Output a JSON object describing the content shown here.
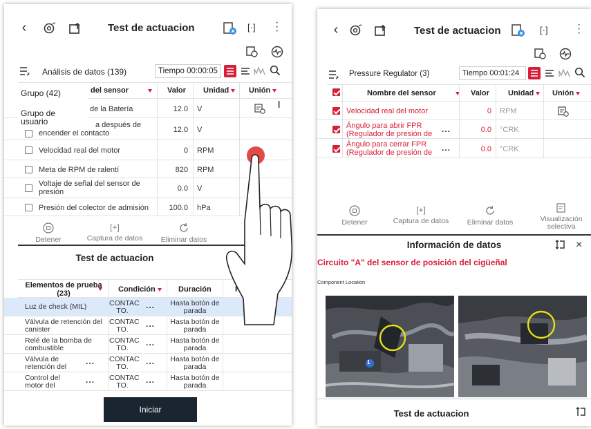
{
  "left": {
    "header": {
      "back": "‹",
      "title": "Test de actuacion"
    },
    "analysis": {
      "label": "Análisis de datos (139)",
      "time": "Tiempo 00:00:05"
    },
    "menu": {
      "group": "Grupo (42)",
      "user_group": "Grupo de usuario"
    },
    "columns": {
      "sensor": "del sensor",
      "value": "Valor",
      "unit": "Unidad",
      "union": "Unión"
    },
    "rows": [
      {
        "name": "de la Batería",
        "value": "12.0",
        "unit": "V"
      },
      {
        "name": "a después de encender el contacto",
        "value": "12.0",
        "unit": "V"
      },
      {
        "name": "Velocidad real del motor",
        "value": "0",
        "unit": "RPM"
      },
      {
        "name": "Meta de RPM de ralentí",
        "value": "820",
        "unit": "RPM"
      },
      {
        "name": "Voltaje de señal del sensor de presión",
        "value": "0.0",
        "unit": "V"
      },
      {
        "name": "Presión del colector de admisión",
        "value": "100.0",
        "unit": "hPa"
      }
    ],
    "toolbar": {
      "stop": "Detener",
      "capture": "Captura de datos",
      "delete": "Eliminar datos"
    },
    "actuation_title": "Test de actuacion",
    "test_columns": {
      "elements": "Elementos de prueba (23)",
      "condition": "Condición",
      "duration": "Duración",
      "result": "Re"
    },
    "tests": [
      {
        "name": "Luz de check (MIL)",
        "condition": "CONTAC TO.",
        "duration": "Hasta botón de parada",
        "selected": true
      },
      {
        "name": "Válvula de retención del canister",
        "condition": "CONTAC TO.",
        "duration": "Hasta botón de parada",
        "selected": false
      },
      {
        "name": "Relé de la bomba de combustible",
        "condition": "CONTAC TO.",
        "duration": "Hasta botón de parada",
        "selected": false
      },
      {
        "name": "Válvula de retención del",
        "condition": "CONTAC TO.",
        "duration": "Hasta botón de parada",
        "selected": false
      },
      {
        "name": "Control del motor del",
        "condition": "CONTAC TO.",
        "duration": "Hasta botón de parada",
        "selected": false
      }
    ],
    "start_button": "Iniciar",
    "dots": "..."
  },
  "right": {
    "header": {
      "back": "‹",
      "title": "Test de actuacion"
    },
    "analysis": {
      "label": "Pressure Regulator (3)",
      "time": "Tiempo 00:01:24"
    },
    "columns": {
      "sensor": "Nombre del sensor",
      "value": "Valor",
      "unit": "Unidad",
      "union": "Unión"
    },
    "rows": [
      {
        "name": "Velocidad real del motor",
        "value": "0",
        "unit": "RPM"
      },
      {
        "name": "Ángulo para abrir FPR (Regulador de presión de",
        "value": "0.0",
        "unit": "°CRK"
      },
      {
        "name": "Ángulo para cerrar FPR (Regulador de presión de",
        "value": "0.0",
        "unit": "°CRK"
      }
    ],
    "toolbar": {
      "stop": "Detener",
      "capture": "Captura de datos",
      "delete": "Eliminar datos",
      "selective": "Visualización selectiva"
    },
    "info_title": "Información de datos",
    "circuit_title": "Circuito \"A\" del sensor de posición del cigüeñal",
    "component_location": "Component Location",
    "badge": "1",
    "bottom_title": "Test de actuacion",
    "dots": "..."
  },
  "colors": {
    "accent": "#d81f3a",
    "dark_button": "#1a2530",
    "selected_row": "#dbe9fb"
  }
}
